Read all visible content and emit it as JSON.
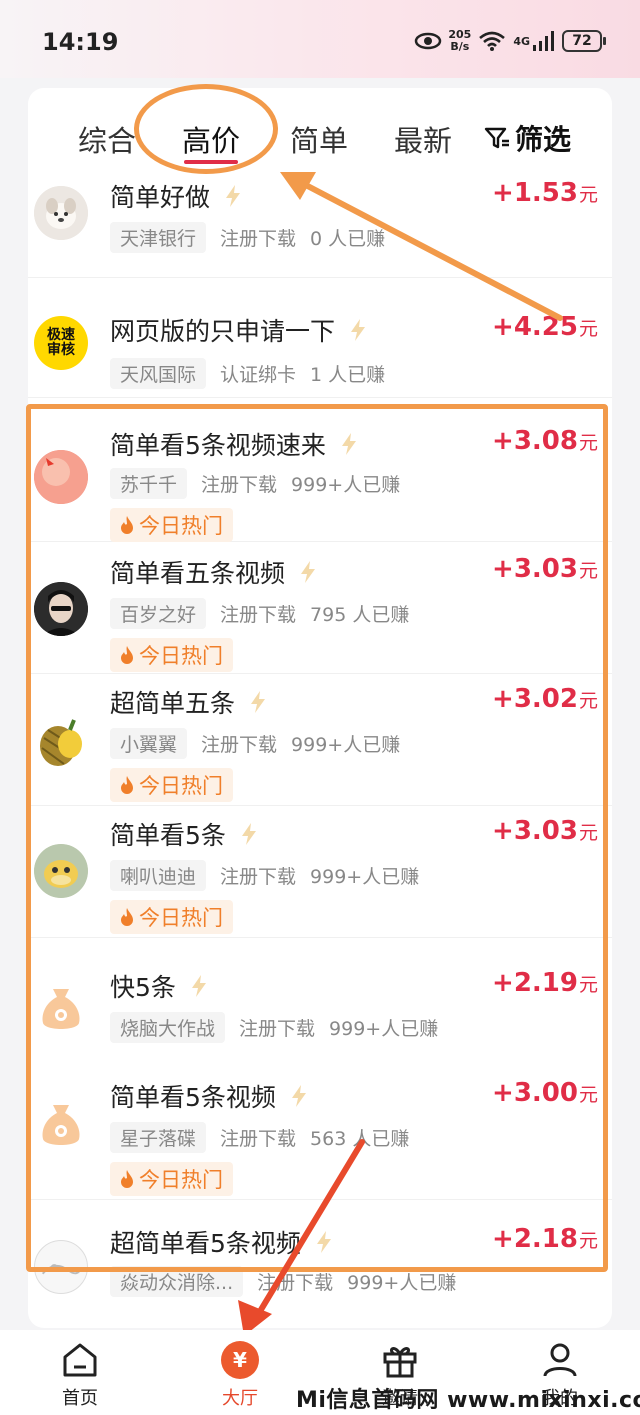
{
  "status_bar": {
    "time": "14:19",
    "net_speed_value": "205",
    "net_speed_unit": "B/s",
    "network": "4G",
    "battery": "72"
  },
  "tabs": [
    {
      "label": "综合",
      "active": false
    },
    {
      "label": "高价",
      "active": true
    },
    {
      "label": "简单",
      "active": false
    },
    {
      "label": "最新",
      "active": false
    }
  ],
  "filter_label": "筛选",
  "tasks": [
    {
      "title": "简单好做",
      "source": "天津银行",
      "action": "注册下载",
      "earned": "0 人已赚",
      "price": "+1.53",
      "unit": "元",
      "hot": null,
      "avatar": "dog-photo-avatar"
    },
    {
      "title": "网页版的只申请一下",
      "source": "天风国际",
      "action": "认证绑卡",
      "earned": "1 人已赚",
      "price": "+4.25",
      "unit": "元",
      "hot": null,
      "avatar": "fast-review-logo",
      "avatar_text_1": "极速",
      "avatar_text_2": "审核"
    },
    {
      "title": "简单看5条视频速来",
      "source": "苏千千",
      "action": "注册下载",
      "earned": "999+人已赚",
      "price": "+3.08",
      "unit": "元",
      "hot": "今日热门",
      "avatar": "peach-avatar"
    },
    {
      "title": "简单看五条视频",
      "source": "百岁之好",
      "action": "注册下载",
      "earned": "795 人已赚",
      "price": "+3.03",
      "unit": "元",
      "hot": "今日热门",
      "avatar": "person-avatar"
    },
    {
      "title": "超简单五条",
      "source": "小翼翼",
      "action": "注册下载",
      "earned": "999+人已赚",
      "price": "+3.02",
      "unit": "元",
      "hot": "今日热门",
      "avatar": "durian-avatar"
    },
    {
      "title": "简单看5条",
      "source": "喇叭迪迪",
      "action": "注册下载",
      "earned": "999+人已赚",
      "price": "+3.03",
      "unit": "元",
      "hot": "今日热门",
      "avatar": "duck-avatar"
    },
    {
      "title": "快5条",
      "source": "烧脑大作战",
      "action": "注册下载",
      "earned": "999+人已赚",
      "price": "+2.19",
      "unit": "元",
      "hot": null,
      "avatar": "money-bag-icon"
    },
    {
      "title": "简单看5条视频",
      "source": "星子落碟",
      "action": "注册下载",
      "earned": "563 人已赚",
      "price": "+3.00",
      "unit": "元",
      "hot": "今日热门",
      "avatar": "money-bag-icon"
    },
    {
      "title": "超简单看5条视频",
      "source": "焱动众消除...",
      "action": "注册下载",
      "earned": "999+人已赚",
      "price": "+2.18",
      "unit": "元",
      "hot": null,
      "avatar": "sketch-avatar"
    }
  ],
  "bottom_nav": [
    {
      "label": "首页",
      "icon": "home-icon",
      "active": false
    },
    {
      "label": "大厅",
      "icon": "yen-hall-icon",
      "active": true,
      "icon_text": "¥"
    },
    {
      "label": "邀请",
      "icon": "gift-icon",
      "active": false
    },
    {
      "label": "我的",
      "icon": "profile-icon",
      "active": false
    }
  ],
  "watermark": "Mi信息首码网 www.mixinxi.com",
  "colors": {
    "accent": "#e02d47",
    "highlight": "#f29a4a",
    "hot": "#f07f2a",
    "nav_active": "#ec5a2e"
  }
}
